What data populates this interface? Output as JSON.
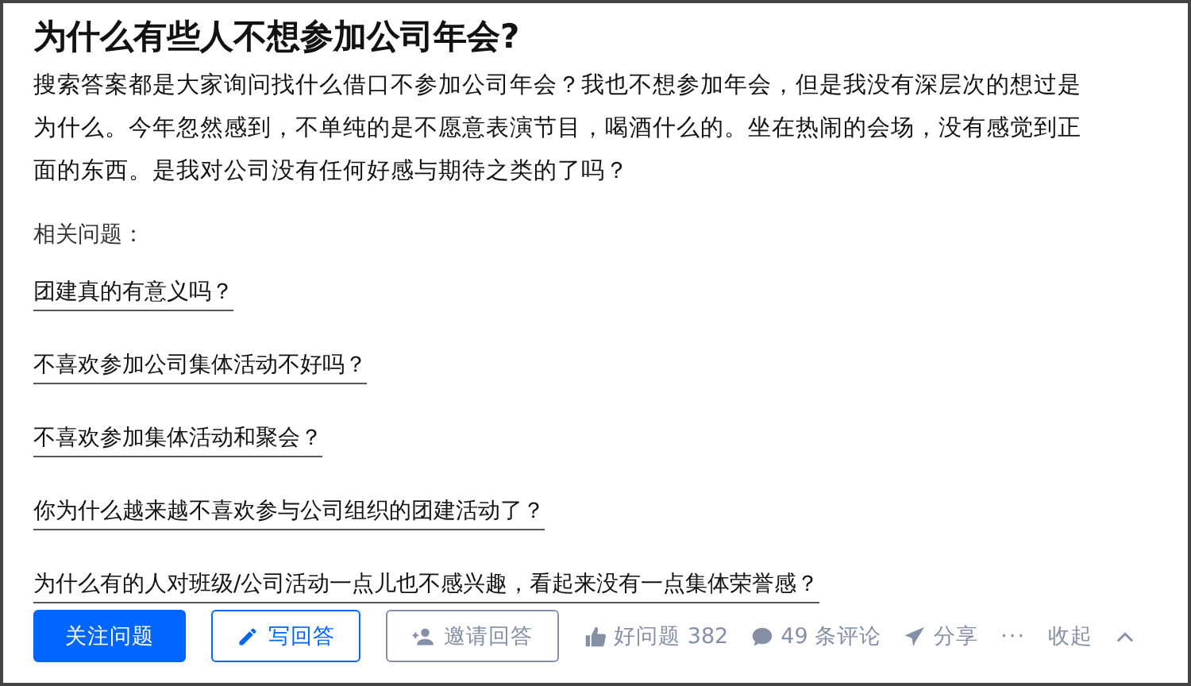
{
  "question": {
    "title": "为什么有些人不想参加公司年会?",
    "body": "搜索答案都是大家询问找什么借口不参加公司年会？我也不想参加年会，但是我没有深层次的想过是为什么。今年忽然感到，不单纯的是不愿意表演节目，喝酒什么的。坐在热闹的会场，没有感觉到正面的东西。是我对公司没有任何好感与期待之类的了吗？",
    "related_label": "相关问题：",
    "related": [
      "团建真的有意义吗？",
      "不喜欢参加公司集体活动不好吗？",
      "不喜欢参加集体活动和聚会？",
      "你为什么越来越不喜欢参与公司组织的团建活动了？",
      "为什么有的人对班级/公司活动一点儿也不感兴趣，看起来没有一点集体荣誉感？"
    ]
  },
  "actions": [
    {
      "kind": "primary",
      "label": "关注问题"
    },
    {
      "kind": "write",
      "label": "写回答"
    },
    {
      "kind": "invite",
      "label": "邀请回答"
    },
    {
      "kind": "like",
      "label": "好问题 382"
    },
    {
      "kind": "comment",
      "label": "49 条评论"
    },
    {
      "kind": "share",
      "label": "分享"
    },
    {
      "kind": "more",
      "label": "···"
    },
    {
      "kind": "collapse",
      "label": "收起"
    }
  ]
}
